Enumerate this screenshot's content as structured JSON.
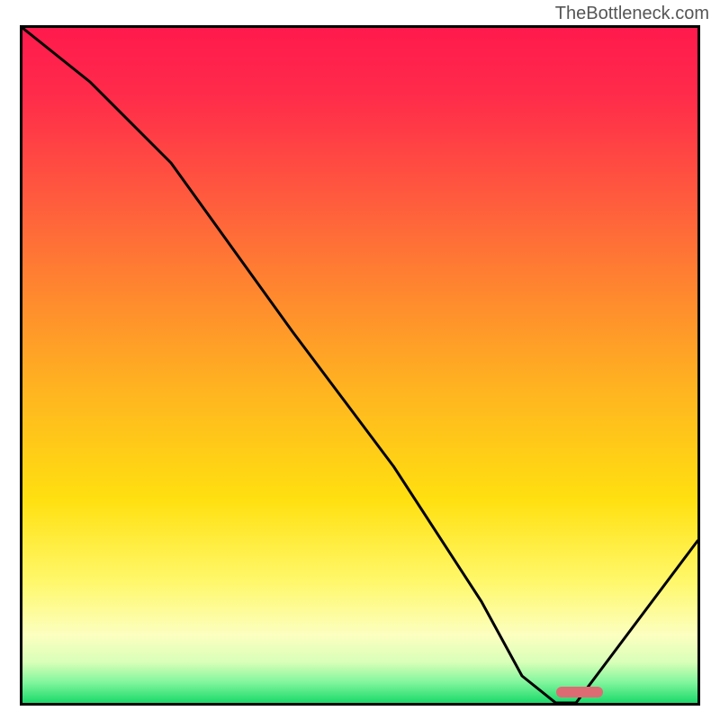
{
  "watermark": "TheBottleneck.com",
  "chart_data": {
    "type": "line",
    "title": "",
    "xlabel": "",
    "ylabel": "",
    "xlim": [
      0,
      100
    ],
    "ylim": [
      0,
      100
    ],
    "series": [
      {
        "name": "bottleneck-curve",
        "x": [
          0,
          10,
          22,
          40,
          55,
          68,
          74,
          79,
          82,
          100
        ],
        "values": [
          100,
          92,
          80,
          55,
          35,
          15,
          4,
          0,
          0,
          24
        ]
      }
    ],
    "annotations": [
      {
        "name": "sweet-spot-marker",
        "x_start": 79,
        "x_end": 86,
        "y": 0,
        "color": "#dd6b74"
      }
    ],
    "gradient_stops": [
      {
        "pos": 0,
        "color": "#ff1a4d"
      },
      {
        "pos": 50,
        "color": "#ffb81f"
      },
      {
        "pos": 80,
        "color": "#fff86a"
      },
      {
        "pos": 100,
        "color": "#1bd96a"
      }
    ]
  }
}
